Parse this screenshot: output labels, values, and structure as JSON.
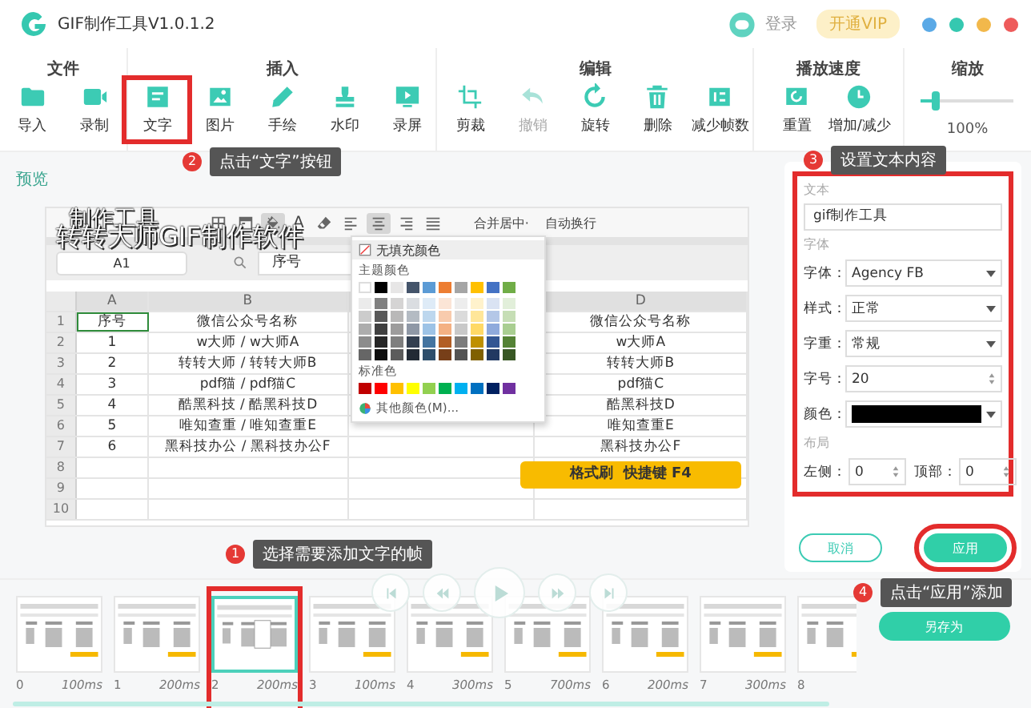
{
  "window": {
    "title": "GIF制作工具V1.0.1.2",
    "login": "登录",
    "vip": "开通VIP"
  },
  "toolbar": [
    {
      "title": "文件",
      "tools": [
        {
          "label": "导入",
          "kind": "folder",
          "disabled": false,
          "highlighted": false
        },
        {
          "label": "录制",
          "kind": "video",
          "disabled": false,
          "highlighted": false
        }
      ]
    },
    {
      "title": "插入",
      "tools": [
        {
          "label": "文字",
          "kind": "text",
          "disabled": false,
          "highlighted": true
        },
        {
          "label": "图片",
          "kind": "image",
          "disabled": false,
          "highlighted": false
        },
        {
          "label": "手绘",
          "kind": "pencil",
          "disabled": false,
          "highlighted": false
        },
        {
          "label": "水印",
          "kind": "stamp",
          "disabled": false,
          "highlighted": false
        },
        {
          "label": "录屏",
          "kind": "screen",
          "disabled": false,
          "highlighted": false
        }
      ]
    },
    {
      "title": "编辑",
      "tools": [
        {
          "label": "剪裁",
          "kind": "crop",
          "disabled": false,
          "highlighted": false
        },
        {
          "label": "撤销",
          "kind": "undo",
          "disabled": true,
          "highlighted": false
        },
        {
          "label": "旋转",
          "kind": "rotate",
          "disabled": false,
          "highlighted": false
        },
        {
          "label": "删除",
          "kind": "trash",
          "disabled": false,
          "highlighted": false
        },
        {
          "label": "减少帧数",
          "kind": "frames",
          "disabled": false,
          "highlighted": false
        }
      ]
    },
    {
      "title": "播放速度",
      "tools": [
        {
          "label": "重置",
          "kind": "spiral",
          "disabled": false,
          "highlighted": false
        },
        {
          "label": "增加/减少",
          "kind": "clock",
          "disabled": false,
          "highlighted": false
        }
      ]
    }
  ],
  "zoom": {
    "title": "缩放",
    "level": 0.15,
    "reading": "100%"
  },
  "preview": {
    "title": "预览",
    "overlay_texts": [
      "制作工具",
      "转转大师GIF制作软件"
    ],
    "sheet": {
      "ribbon": [
        {
          "kind": "borders",
          "active": false
        },
        {
          "kind": "format",
          "active": false
        },
        {
          "kind": "fill",
          "active": true
        },
        {
          "kind": "font-color",
          "text": "A",
          "active": false
        },
        {
          "kind": "clear",
          "active": false
        },
        {
          "kind": "align-left",
          "active": false
        },
        {
          "kind": "align-center",
          "active": true
        },
        {
          "kind": "align-right",
          "active": false
        },
        {
          "kind": "justify",
          "active": false
        }
      ],
      "ribbon_texts": [
        "合并居中·",
        "自动换行"
      ],
      "name_box": "A1",
      "formula": "序号",
      "columns": [
        "A",
        "B",
        "",
        "D"
      ],
      "rows": [
        {
          "header": "1",
          "cells": [
            "序号",
            "微信公众号名称",
            "",
            "微信公众号名称"
          ]
        },
        {
          "header": "2",
          "cells": [
            "1",
            "w大师 / w大师A",
            "",
            "w大师A"
          ]
        },
        {
          "header": "3",
          "cells": [
            "2",
            "转转大师 / 转转大师B",
            "",
            "转转大师B"
          ]
        },
        {
          "header": "4",
          "cells": [
            "3",
            "pdf猫 / pdf猫C",
            "",
            "pdf猫C"
          ]
        },
        {
          "header": "5",
          "cells": [
            "4",
            "酷黑科技 / 酷黑科技D",
            "",
            "酷黑科技D"
          ]
        },
        {
          "header": "6",
          "cells": [
            "5",
            "唯知查重 / 唯知查重E",
            "",
            "唯知查重E"
          ]
        },
        {
          "header": "7",
          "cells": [
            "6",
            "黑科技办公 / 黑科技办公F",
            "",
            "黑科技办公F"
          ]
        },
        {
          "header": "8",
          "cells": [
            "",
            "",
            "",
            ""
          ]
        },
        {
          "header": "9",
          "cells": [
            "",
            "",
            "",
            ""
          ]
        },
        {
          "header": "10",
          "cells": [
            "",
            "",
            "",
            ""
          ]
        }
      ],
      "banner": "格式刷  快捷键 F4",
      "palette": {
        "no_fill": "无填充颜色",
        "theme_title": "主题颜色",
        "theme_colors": [
          {
            "color": "#ffffff"
          },
          {
            "color": "#000000"
          },
          {
            "color": "#e7e6e6"
          },
          {
            "color": "#44546a"
          },
          {
            "color": "#5b9bd5"
          },
          {
            "color": "#ed7d31"
          },
          {
            "color": "#a5a5a5"
          },
          {
            "color": "#ffc000"
          },
          {
            "color": "#4472c4"
          },
          {
            "color": "#70ad47"
          }
        ],
        "standard_title": "标准色",
        "standard_colors": [
          {
            "color": "#c00000"
          },
          {
            "color": "#ff0000"
          },
          {
            "color": "#ffc000"
          },
          {
            "color": "#ffff00"
          },
          {
            "color": "#92d050"
          },
          {
            "color": "#00b050"
          },
          {
            "color": "#00b0f0"
          },
          {
            "color": "#0070c0"
          },
          {
            "color": "#002060"
          },
          {
            "color": "#7030a0"
          }
        ],
        "more": "其他颜色(M)..."
      }
    }
  },
  "panel": {
    "highlighted": true,
    "text_title": "文本",
    "text_value": "gif制作工具",
    "font_title": "字体",
    "fields": [
      {
        "label": "字体：",
        "kind": "select",
        "value": "Agency FB"
      },
      {
        "label": "样式：",
        "kind": "select",
        "value": "正常"
      },
      {
        "label": "字重：",
        "kind": "select",
        "value": "常规"
      },
      {
        "label": "字号：",
        "kind": "spinner",
        "value": "20"
      },
      {
        "label": "颜色：",
        "kind": "color",
        "color": "#000000"
      }
    ],
    "layout_title": "布局",
    "layout_fields": [
      {
        "label": "左侧：",
        "value": "0"
      },
      {
        "label": "顶部：",
        "value": "0"
      }
    ],
    "cancel": "取消",
    "apply": "应用",
    "apply_highlighted": true
  },
  "playback": [
    {
      "kind": "first"
    },
    {
      "kind": "prev"
    },
    {
      "kind": "play"
    },
    {
      "kind": "next"
    },
    {
      "kind": "last"
    }
  ],
  "frames": [
    {
      "index": "0",
      "duration": "100ms",
      "selected": false,
      "highlighted": false,
      "banner": true
    },
    {
      "index": "1",
      "duration": "200ms",
      "selected": false,
      "highlighted": false,
      "banner": true
    },
    {
      "index": "2",
      "duration": "200ms",
      "selected": true,
      "highlighted": true,
      "banner": false
    },
    {
      "index": "3",
      "duration": "100ms",
      "selected": false,
      "highlighted": false,
      "banner": true
    },
    {
      "index": "4",
      "duration": "300ms",
      "selected": false,
      "highlighted": false,
      "banner": true
    },
    {
      "index": "5",
      "duration": "700ms",
      "selected": false,
      "highlighted": false,
      "banner": true
    },
    {
      "index": "6",
      "duration": "200ms",
      "selected": false,
      "highlighted": false,
      "banner": true
    },
    {
      "index": "7",
      "duration": "300ms",
      "selected": false,
      "highlighted": false,
      "banner": true
    },
    {
      "index": "8",
      "selected": false,
      "highlighted": false,
      "banner": true
    }
  ],
  "save_as": "另存为",
  "callouts": [
    {
      "number": "1",
      "text": "选择需要添加文字的帧"
    },
    {
      "number": "2",
      "text": "点击“文字”按钮"
    },
    {
      "number": "3",
      "text": "设置文本内容"
    },
    {
      "number": "4",
      "text": "点击“应用”添加"
    }
  ]
}
